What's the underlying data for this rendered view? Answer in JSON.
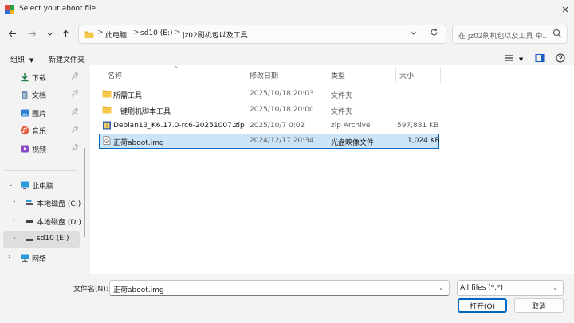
{
  "window": {
    "title": "Select your aboot file.."
  },
  "nav": {
    "back_icon": "arrow-left-icon",
    "forward_icon": "arrow-right-icon",
    "recent_icon": "chevron-down-icon",
    "up_icon": "arrow-up-icon"
  },
  "address": {
    "crumbs": [
      "此电脑",
      "sd10 (E:)",
      "jz02刷机包以及工具"
    ],
    "separator": ">"
  },
  "search": {
    "placeholder": "在 jz02刷机包以及工具 中..."
  },
  "toolbar": {
    "organize": "组织",
    "new_folder": "新建文件夹"
  },
  "sidebar": {
    "quick": [
      {
        "label": "下载",
        "icon": "download-icon"
      },
      {
        "label": "文档",
        "icon": "document-icon"
      },
      {
        "label": "图片",
        "icon": "pictures-icon"
      },
      {
        "label": "音乐",
        "icon": "music-icon"
      },
      {
        "label": "视频",
        "icon": "video-icon"
      }
    ],
    "tree": [
      {
        "label": "此电脑",
        "icon": "computer-icon"
      },
      {
        "label": "本地磁盘 (C:)",
        "icon": "drive-icon"
      },
      {
        "label": "本地磁盘 (D:)",
        "icon": "drive-icon"
      },
      {
        "label": "sd10 (E:)",
        "icon": "drive-icon"
      },
      {
        "label": "网络",
        "icon": "network-icon"
      }
    ]
  },
  "columns": {
    "name": "名称",
    "modified": "修改日期",
    "type": "类型",
    "size": "大小"
  },
  "files": [
    {
      "name": "所需工具",
      "modified": "2025/10/18 20:03",
      "type": "文件夹",
      "size": "",
      "icon": "folder-icon"
    },
    {
      "name": "一键刷机脚本工具",
      "modified": "2025/10/18 20:00",
      "type": "文件夹",
      "size": "",
      "icon": "folder-icon"
    },
    {
      "name": "Debian13_K6.17.0-rc6-20251007.zip",
      "modified": "2025/10/7 0:02",
      "type": "zip Archive",
      "size": "597,881 KB",
      "icon": "zip-archive-icon"
    },
    {
      "name": "正荷aboot.img",
      "modified": "2024/12/17 20:34",
      "type": "光盘映像文件",
      "size": "1,024 KB",
      "icon": "disc-image-icon"
    }
  ],
  "bottom": {
    "filename_label": "文件名(N):",
    "filename_value": "正荷aboot.img",
    "filter_value": "All files (*.*)",
    "open_label": "打开(O)",
    "cancel_label": "取消"
  },
  "colors": {
    "accent": "#0067c0",
    "selection": "#cce4f7",
    "folder": "#e8b230"
  }
}
